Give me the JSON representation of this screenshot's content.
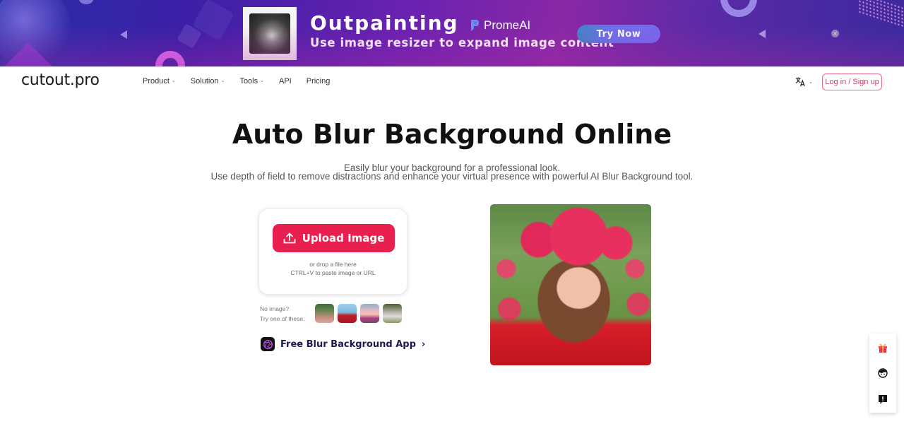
{
  "banner": {
    "title": "Outpainting",
    "subtitle": "Use image resizer to expand image content",
    "brand": "PromeAI",
    "cta_label": "Try Now",
    "close_label": "×",
    "colors": {
      "cta_start": "#3e86c6",
      "cta_end": "#7868f0"
    }
  },
  "nav": {
    "logo": "cutout.pro",
    "items": [
      {
        "label": "Product",
        "has_dropdown": true
      },
      {
        "label": "Solution",
        "has_dropdown": true
      },
      {
        "label": "Tools",
        "has_dropdown": true
      },
      {
        "label": "API",
        "has_dropdown": false
      },
      {
        "label": "Pricing",
        "has_dropdown": false
      }
    ],
    "language_icon": "translate-icon",
    "login_label": "Log in / Sign up",
    "dropdown_glyph": "⌄"
  },
  "hero": {
    "title": "Auto Blur Background Online",
    "subtitle_line1": "Easily blur your background for a professional look.",
    "subtitle_line2": "Use depth of field to remove distractions and enhance your virtual presence with powerful AI Blur Background tool."
  },
  "upload": {
    "button_label": "Upload Image",
    "hint_line1": "or drop a file here",
    "hint_line2": "CTRL+V to paste image or URL",
    "accent_color": "#e8204f"
  },
  "samples": {
    "label_line1": "No image?",
    "label_line2": "Try one of these:",
    "items": [
      {
        "name": "sample-woman-pink-sweater"
      },
      {
        "name": "sample-man-red-sweater"
      },
      {
        "name": "sample-child-pink-hat"
      },
      {
        "name": "sample-person-outdoors"
      }
    ]
  },
  "app_link": {
    "label": "Free Blur Background App",
    "chevron": "›",
    "color": "#1c1850"
  },
  "demo_image": {
    "alt": "Woman with pink flower crown in a tulip field"
  },
  "side_toolbar": {
    "items": [
      {
        "icon": "gift-icon"
      },
      {
        "icon": "support-agent-icon"
      },
      {
        "icon": "feedback-icon"
      }
    ]
  }
}
